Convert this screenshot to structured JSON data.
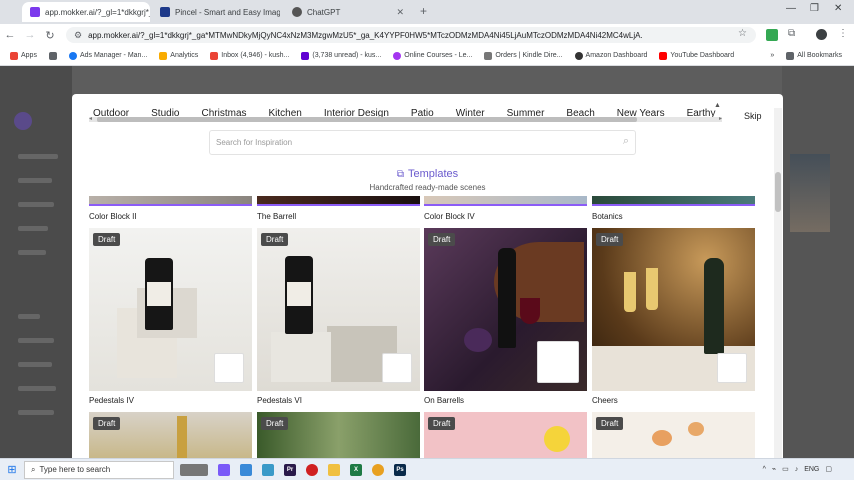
{
  "browser": {
    "tabs": [
      {
        "title": "app.mokker.ai/?_gl=1*dkkgrj*_",
        "active": true,
        "favicon_color": "#7c3aed"
      },
      {
        "title": "Pincel - Smart and Easy Image",
        "active": false,
        "favicon_color": "#1e3a8a"
      },
      {
        "title": "ChatGPT",
        "active": false,
        "favicon_color": "#555555"
      }
    ],
    "close_glyph": "✕",
    "new_tab_glyph": "+",
    "window_controls": [
      "—",
      "❐",
      "✕"
    ],
    "url": "app.mokker.ai/?_gl=1*dkkgrj*_ga*MTMwNDkyMjQyNC4xNzM3MzgwMzU5*_ga_K4YYPF0HW5*MTczODMzMDA4Ni45LjAuMTczODMzMDA4Ni42MC4wLjA.",
    "bookmarks": [
      {
        "label": "Apps",
        "color": "#ea4335"
      },
      {
        "label": "",
        "color": "#5f6368"
      },
      {
        "label": "Ads Manager - Man...",
        "color": "#1877f2"
      },
      {
        "label": "Analytics",
        "color": "#f9ab00"
      },
      {
        "label": "Inbox (4,946) - kush...",
        "color": "#ea4335"
      },
      {
        "label": "(3,738 unread) - kus...",
        "color": "#6001d2"
      },
      {
        "label": "Online Courses - Le...",
        "color": "#a435f0"
      },
      {
        "label": "Orders | Kindle Dire...",
        "color": "#777777"
      },
      {
        "label": "Amazon Dashboard",
        "color": "#333333"
      },
      {
        "label": "YouTube Dashboard",
        "color": "#ff0000"
      }
    ],
    "more_bookmarks": "»",
    "all_bookmarks": "All Bookmarks"
  },
  "modal": {
    "chips": [
      "Outdoor",
      "Studio",
      "Christmas",
      "Kitchen",
      "Interior Design",
      "Patio",
      "Winter",
      "Summer",
      "Beach",
      "New Years",
      "Earthy"
    ],
    "skip_label": "Skip",
    "search_placeholder": "Search for Inspiration",
    "section_title": "Templates",
    "section_subtitle": "Handcrafted ready-made scenes",
    "top_row_captions": [
      "Color Block II",
      "The Barrell",
      "Color Block IV",
      "Botanics"
    ],
    "cards_row1": [
      {
        "caption": "Pedestals IV",
        "badge": "Draft"
      },
      {
        "caption": "Pedestals VI",
        "badge": "Draft"
      },
      {
        "caption": "On Barrells",
        "badge": "Draft"
      },
      {
        "caption": "Cheers",
        "badge": "Draft"
      }
    ],
    "cards_row2": [
      {
        "badge": "Draft"
      },
      {
        "badge": "Draft"
      },
      {
        "badge": "Draft"
      },
      {
        "badge": "Draft"
      }
    ]
  },
  "taskbar": {
    "search_placeholder": "Type here to search",
    "language": "ENG"
  }
}
